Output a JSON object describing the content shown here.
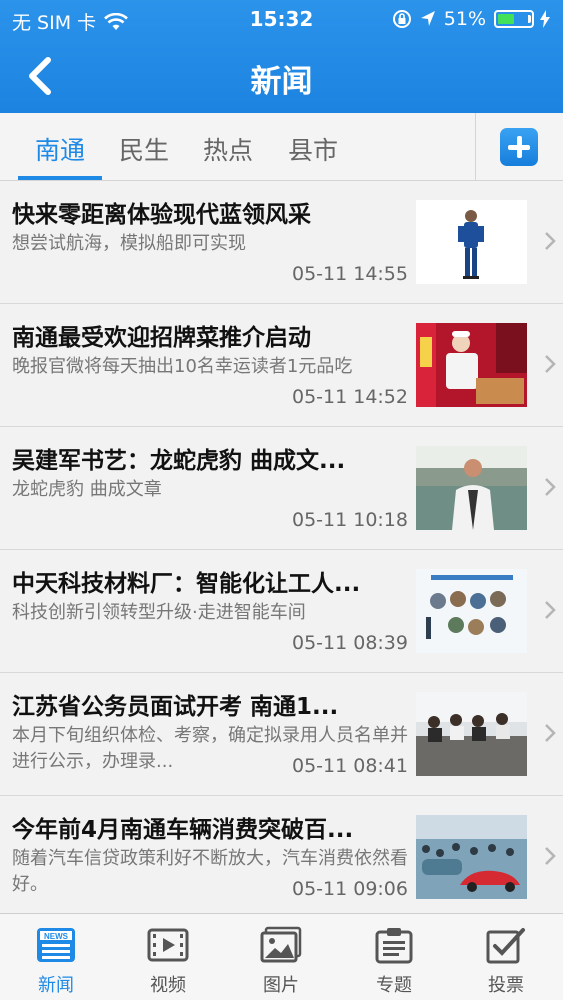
{
  "status_bar": {
    "carrier": "无 SIM 卡",
    "time": "15:32",
    "battery": "51%",
    "battery_level": 0.51
  },
  "nav": {
    "title": "新闻"
  },
  "tabs": [
    {
      "label": "南通",
      "active": true
    },
    {
      "label": "民生",
      "active": false
    },
    {
      "label": "热点",
      "active": false
    },
    {
      "label": "县市",
      "active": false
    }
  ],
  "news": [
    {
      "title": "快来零距离体验现代蓝领风采",
      "summary": "想尝试航海，模拟船即可实现",
      "time": "05-11 14:55"
    },
    {
      "title": "南通最受欢迎招牌菜推介启动",
      "summary": "晚报官微将每天抽出10名幸运读者1元品吃",
      "time": "05-11 14:52"
    },
    {
      "title": "吴建军书艺：龙蛇虎豹 曲成文...",
      "summary": "龙蛇虎豹 曲成文章",
      "time": "05-11 10:18"
    },
    {
      "title": "中天科技材料厂：智能化让工人...",
      "summary": "科技创新引领转型升级·走进智能车间",
      "time": "05-11 08:39"
    },
    {
      "title": "江苏省公务员面试开考 南通1...",
      "summary": "本月下旬组织体检、考察，确定拟录用人员名单并进行公示，办理录...",
      "time": "05-11 08:41"
    },
    {
      "title": "今年前4月南通车辆消费突破百...",
      "summary": "随着汽车信贷政策利好不断放大，汽车消费依然看好。",
      "time": "05-11 09:06"
    }
  ],
  "tabbar": [
    {
      "label": "新闻",
      "icon": "news-icon",
      "active": true
    },
    {
      "label": "视频",
      "icon": "video-icon",
      "active": false
    },
    {
      "label": "图片",
      "icon": "picture-icon",
      "active": false
    },
    {
      "label": "专题",
      "icon": "topic-icon",
      "active": false
    },
    {
      "label": "投票",
      "icon": "vote-icon",
      "active": false
    }
  ],
  "colors": {
    "header_blue": "#1f8ae6",
    "accent": "#1f8ae6"
  }
}
